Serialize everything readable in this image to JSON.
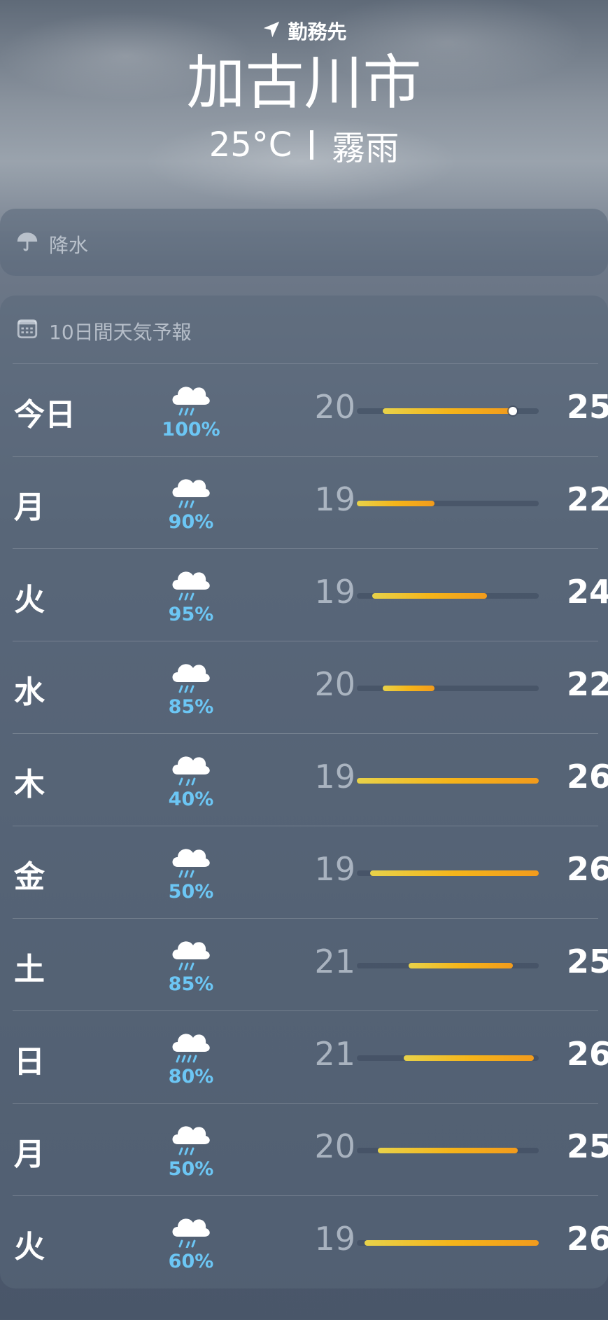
{
  "header": {
    "location_label": "勤務先",
    "city": "加古川市",
    "temperature": "25°C",
    "condition": "霧雨"
  },
  "precipitation_card": {
    "title": "降水",
    "icon": "umbrella-icon"
  },
  "forecast_card": {
    "title": "10日間天気予報",
    "icon": "calendar-icon",
    "range_scale": {
      "min": 19,
      "max": 26
    },
    "days": [
      {
        "day": "今日",
        "icon": "rain-cloud-icon",
        "chance": "100%",
        "low": "20",
        "high": "25",
        "bar_low": 20,
        "bar_high": 25,
        "current": 25
      },
      {
        "day": "月",
        "icon": "rain-cloud-icon",
        "chance": "90%",
        "low": "19",
        "high": "22",
        "bar_low": 19,
        "bar_high": 22
      },
      {
        "day": "火",
        "icon": "rain-cloud-icon",
        "chance": "95%",
        "low": "19",
        "high": "24",
        "bar_low": 19.6,
        "bar_high": 24
      },
      {
        "day": "水",
        "icon": "rain-cloud-icon",
        "chance": "85%",
        "low": "20",
        "high": "22",
        "bar_low": 20,
        "bar_high": 22
      },
      {
        "day": "木",
        "icon": "drizzle-cloud-icon",
        "chance": "40%",
        "low": "19",
        "high": "26",
        "bar_low": 19,
        "bar_high": 26
      },
      {
        "day": "金",
        "icon": "rain-cloud-icon",
        "chance": "50%",
        "low": "19",
        "high": "26",
        "bar_low": 19.5,
        "bar_high": 26
      },
      {
        "day": "土",
        "icon": "rain-cloud-icon",
        "chance": "85%",
        "low": "21",
        "high": "25",
        "bar_low": 21,
        "bar_high": 25
      },
      {
        "day": "日",
        "icon": "heavy-rain-cloud-icon",
        "chance": "80%",
        "low": "21",
        "high": "26",
        "bar_low": 20.8,
        "bar_high": 25.8
      },
      {
        "day": "月",
        "icon": "rain-cloud-icon",
        "chance": "50%",
        "low": "20",
        "high": "25",
        "bar_low": 19.8,
        "bar_high": 25.2
      },
      {
        "day": "火",
        "icon": "drizzle-cloud-icon",
        "chance": "60%",
        "low": "19",
        "high": "26",
        "bar_low": 19.3,
        "bar_high": 26
      }
    ]
  },
  "colors": {
    "precip_text": "#6cc6f4",
    "bar_start": "#e8d24a",
    "bar_end": "#f29b1c"
  }
}
